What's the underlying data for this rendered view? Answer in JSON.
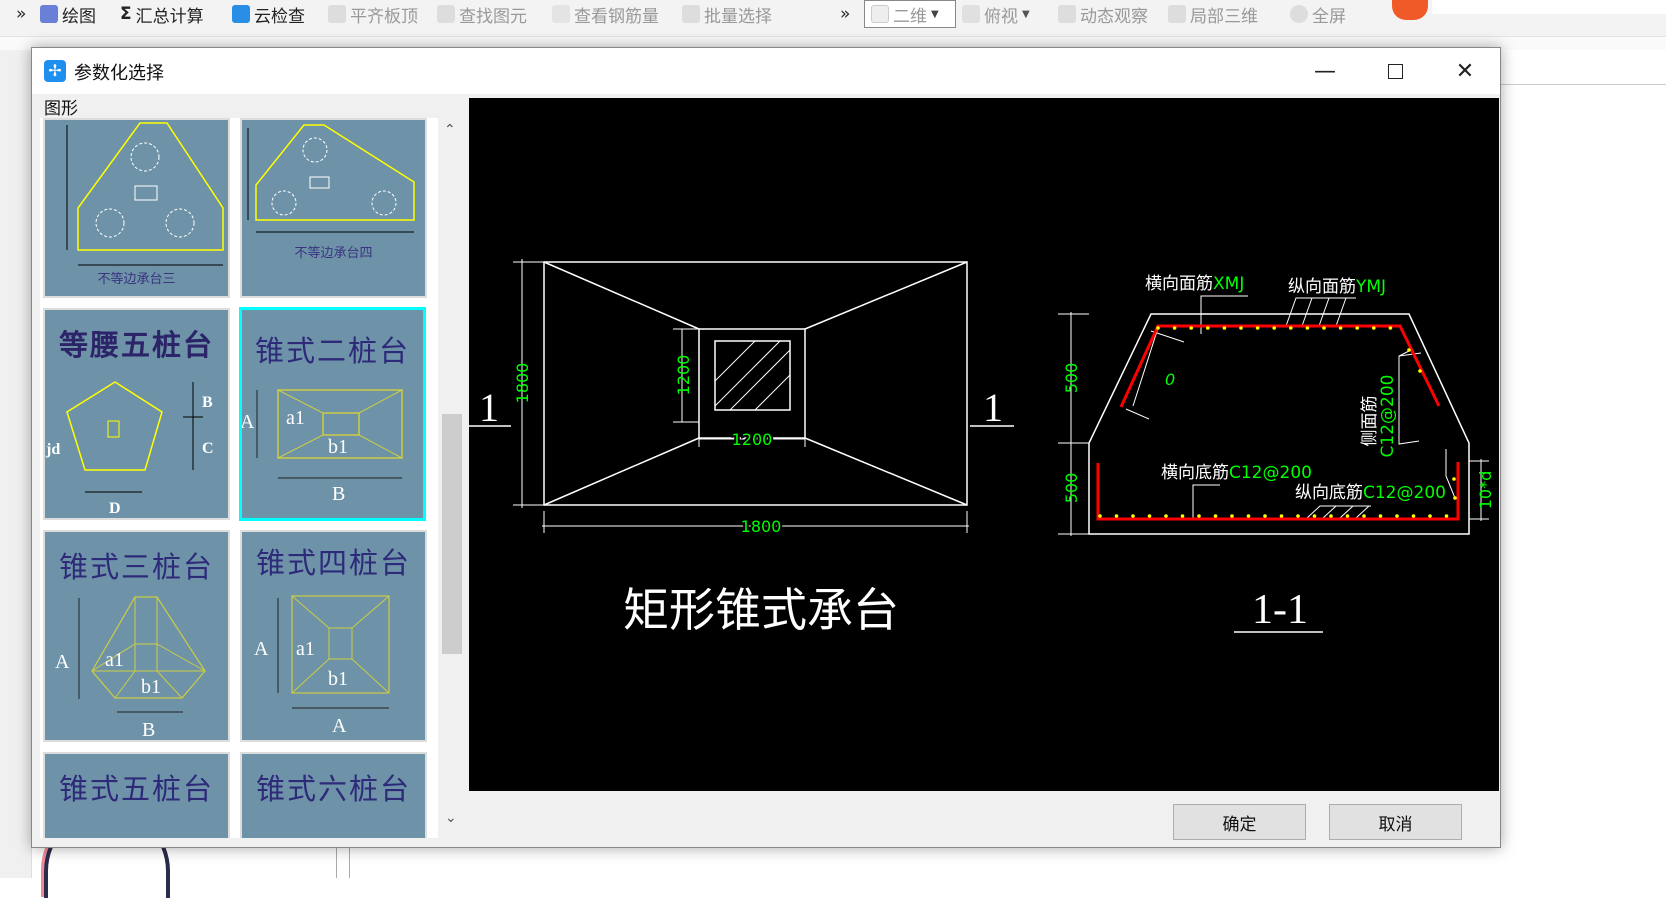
{
  "toolbar": {
    "overflow_left": "»",
    "items": [
      {
        "label": "绘图",
        "disabled": false
      },
      {
        "label": "汇总计算",
        "disabled": false
      },
      {
        "label": "云检查",
        "disabled": false
      },
      {
        "label": "平齐板顶",
        "disabled": true
      },
      {
        "label": "查找图元",
        "disabled": true
      },
      {
        "label": "查看钢筋量",
        "disabled": true
      },
      {
        "label": "批量选择",
        "disabled": true
      }
    ],
    "overflow_right": "»",
    "view_select": "二维",
    "items2": [
      {
        "label": "俯视"
      },
      {
        "label": "动态观察"
      },
      {
        "label": "局部三维"
      },
      {
        "label": "全屏"
      }
    ],
    "sigma": "Σ"
  },
  "dialog": {
    "title": "参数化选择",
    "shapes_label": "图形",
    "gallery": [
      {
        "caption": "不等边承台三",
        "selected": false
      },
      {
        "caption": "不等边承台四",
        "selected": false
      },
      {
        "caption": "等腰五桩台",
        "selected": false,
        "dims": [
          "B",
          "C",
          "D",
          "jd"
        ]
      },
      {
        "caption": "锥式二桩台",
        "selected": true,
        "dims": [
          "A",
          "a1",
          "b1",
          "B"
        ]
      },
      {
        "caption": "锥式三桩台",
        "selected": false,
        "dims": [
          "A",
          "a1",
          "b1",
          "B"
        ]
      },
      {
        "caption": "锥式四桩台",
        "selected": false,
        "dims": [
          "A",
          "a1",
          "b1",
          "A"
        ]
      },
      {
        "caption": "锥式五桩台",
        "selected": false
      },
      {
        "caption": "锥式六桩台",
        "selected": false
      }
    ],
    "preview": {
      "plan_title": "矩形锥式承台",
      "section_title": "1-1",
      "section_mark": "1",
      "plan_dims": {
        "outer_h": "1800",
        "outer_w": "1800",
        "inner_h": "1200",
        "inner_w": "1200"
      },
      "section_dims": {
        "top": "500",
        "bottom": "500",
        "hook": "10*d",
        "slope": "0"
      },
      "labels": {
        "top_x": "横向面筋",
        "top_x_code": "XMJ",
        "top_y": "纵向面筋",
        "top_y_code": "YMJ",
        "bottom_x": "横向底筋",
        "bottom_x_code": "C12@200",
        "bottom_y": "纵向底筋",
        "bottom_y_code": "C12@200",
        "side": "侧面筋",
        "side_code": "C12@200"
      },
      "colors": {
        "rebar": "#ff0000",
        "dim": "#00ff00",
        "line": "#ffffff",
        "dot": "#ffff00"
      }
    },
    "ok_label": "确定",
    "cancel_label": "取消"
  }
}
